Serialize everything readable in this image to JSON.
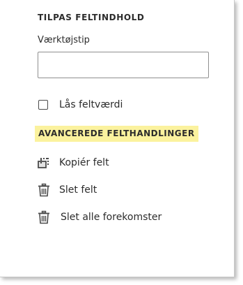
{
  "panel": {
    "section_title": "TILPAS FELTINDHOLD",
    "tooltip_label": "Værktøjstip",
    "tooltip_value": "",
    "lock_label": "Lås feltværdi",
    "advanced_title": "AVANCEREDE FELTHANDLINGER",
    "actions": [
      {
        "label": "Kopiér felt",
        "icon": "copy-icon"
      },
      {
        "label": "Slet felt",
        "icon": "trash-icon"
      },
      {
        "label": "Slet alle forekomster",
        "icon": "trash-icon"
      }
    ]
  },
  "colors": {
    "highlight": "#fbf29e",
    "text": "#2c2c2c",
    "border": "#8f8f8f"
  }
}
